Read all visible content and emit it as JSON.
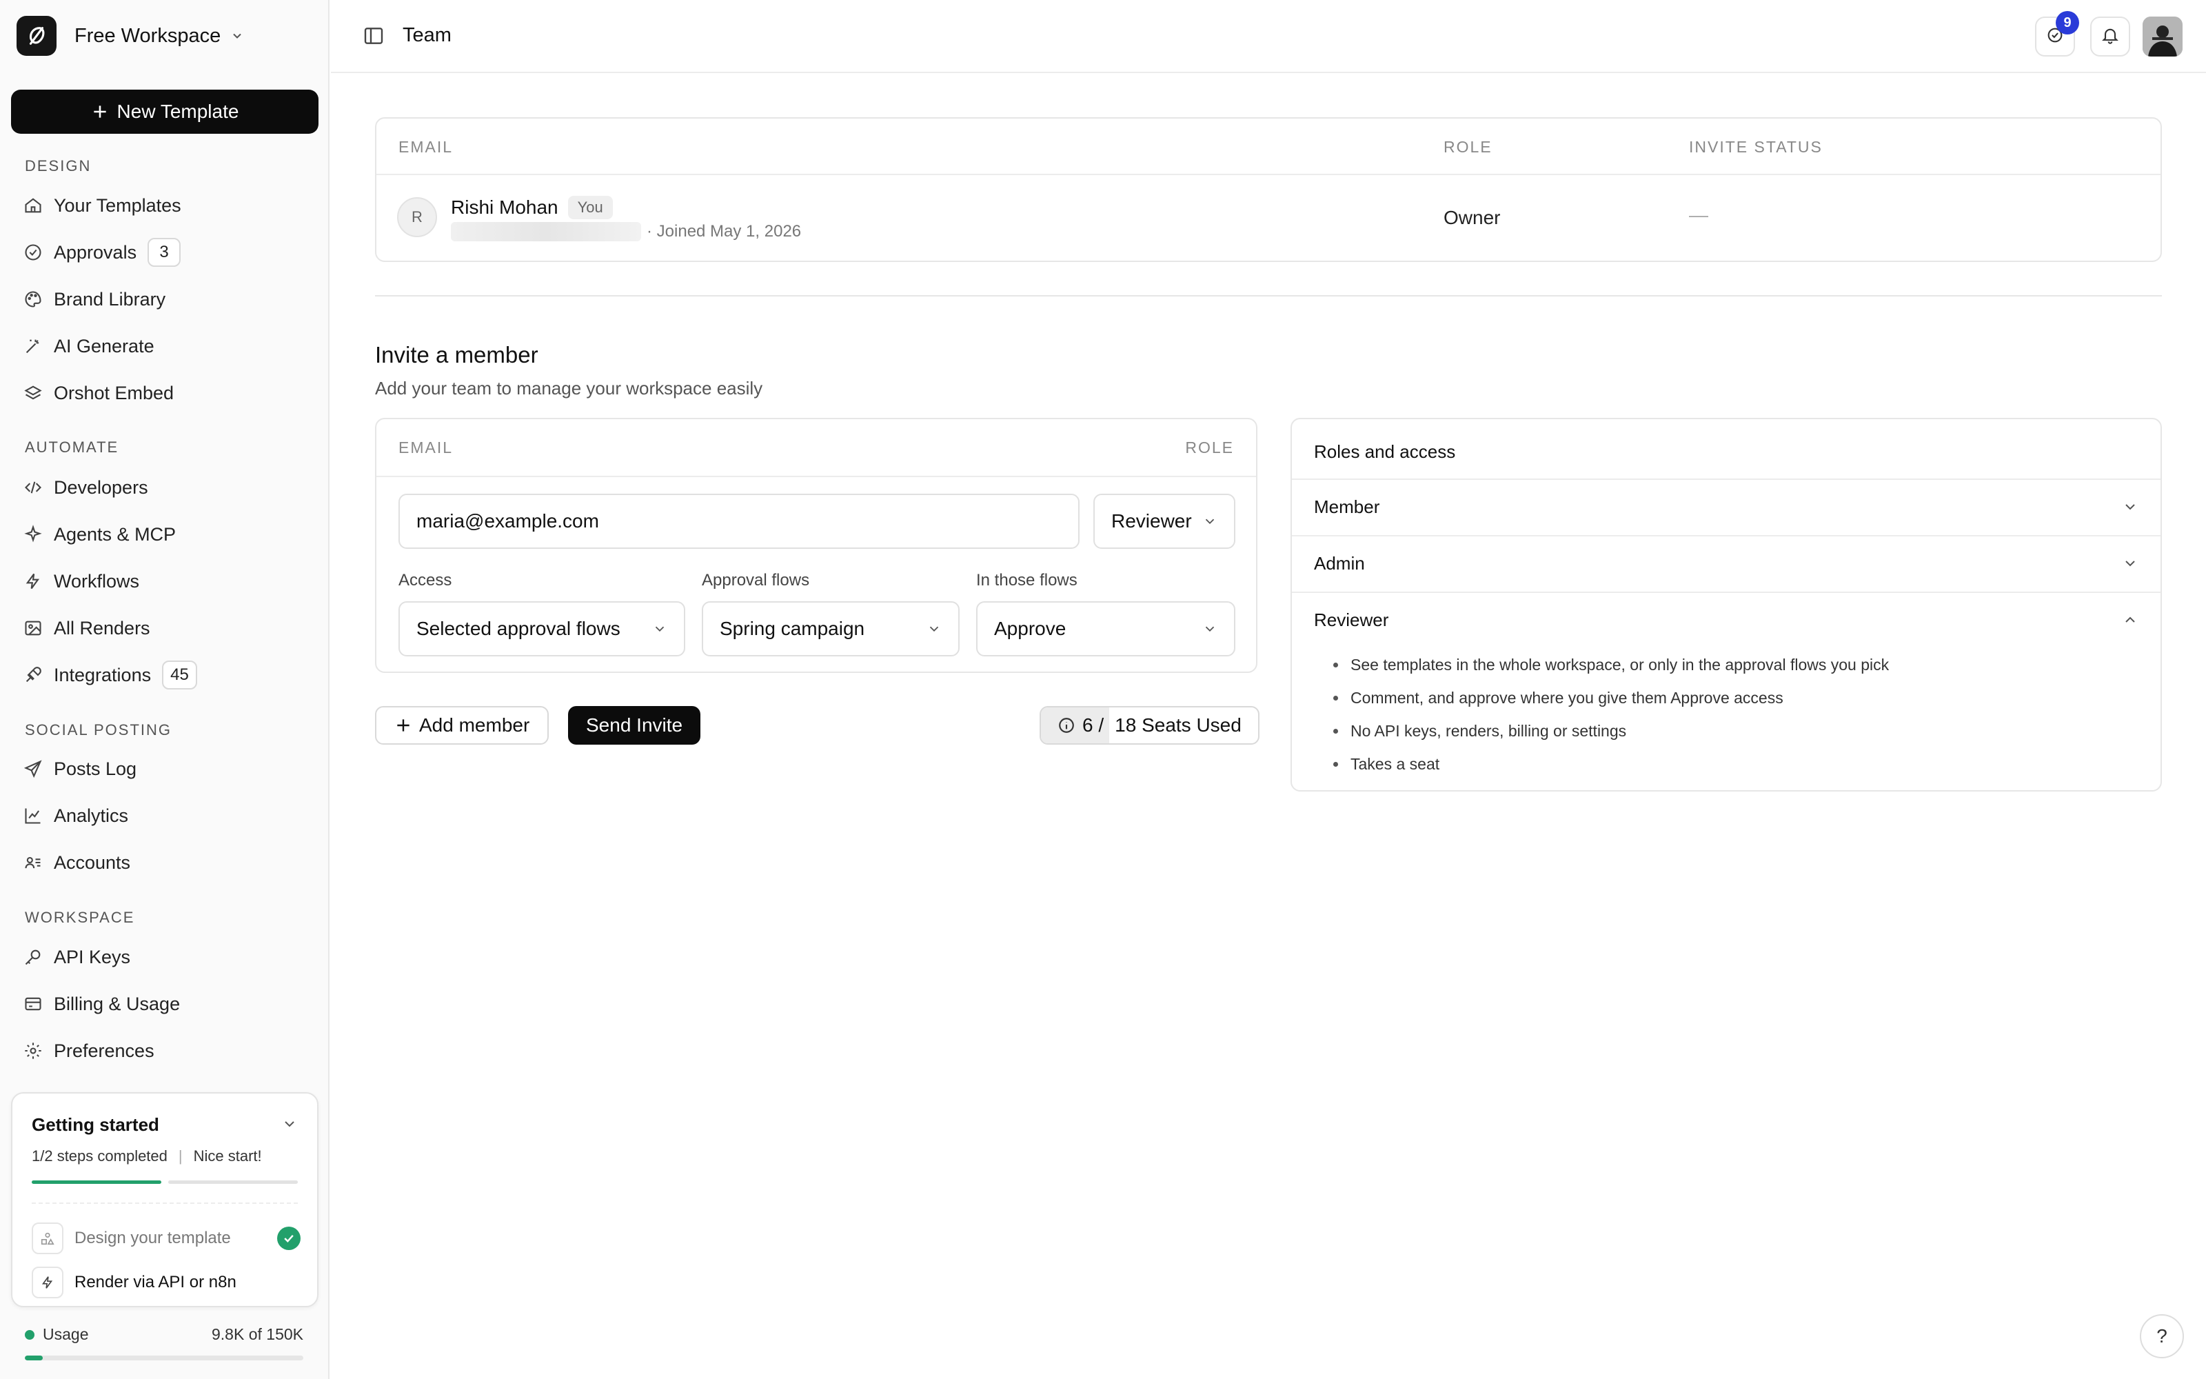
{
  "workspace": {
    "name": "Free Workspace"
  },
  "sidebar": {
    "new_template": "New Template",
    "sections": {
      "design": "DESIGN",
      "automate": "AUTOMATE",
      "social": "SOCIAL POSTING",
      "workspace": "WORKSPACE"
    },
    "items": [
      {
        "label": "Your Templates",
        "icon": "home-icon"
      },
      {
        "label": "Approvals",
        "icon": "check-circle-icon",
        "badge": "3"
      },
      {
        "label": "Brand Library",
        "icon": "palette-icon"
      },
      {
        "label": "AI Generate",
        "icon": "magic-wand-icon"
      },
      {
        "label": "Orshot Embed",
        "icon": "layers-icon"
      },
      {
        "label": "Developers",
        "icon": "code-icon"
      },
      {
        "label": "Agents & MCP",
        "icon": "sparkle-icon"
      },
      {
        "label": "Workflows",
        "icon": "bolt-icon"
      },
      {
        "label": "All Renders",
        "icon": "image-icon"
      },
      {
        "label": "Integrations",
        "icon": "plug-icon",
        "badge": "45"
      },
      {
        "label": "Posts Log",
        "icon": "send-icon"
      },
      {
        "label": "Analytics",
        "icon": "chart-line-icon"
      },
      {
        "label": "Accounts",
        "icon": "users-icon"
      },
      {
        "label": "API Keys",
        "icon": "key-icon"
      },
      {
        "label": "Billing & Usage",
        "icon": "credit-card-icon"
      },
      {
        "label": "Preferences",
        "icon": "gear-icon"
      }
    ],
    "getting_started": {
      "title": "Getting started",
      "steps_text": "1/2 steps completed",
      "encouragement": "Nice start!",
      "progress": 0.5,
      "steps": [
        {
          "label": "Design your template",
          "done": true
        },
        {
          "label": "Render via API or n8n",
          "done": false
        }
      ]
    },
    "usage": {
      "label": "Usage",
      "value": "9.8K of 150K",
      "fraction": 0.065
    }
  },
  "topbar": {
    "title": "Team",
    "notification_badge": "9"
  },
  "team_table": {
    "headers": {
      "email": "EMAIL",
      "role": "ROLE",
      "status": "INVITE STATUS"
    },
    "rows": [
      {
        "initial": "R",
        "name": "Rishi Mohan",
        "tag": "You",
        "meta": "· Joined May 1, 2026",
        "role": "Owner",
        "status": "—"
      }
    ]
  },
  "invite": {
    "title": "Invite a member",
    "subtitle": "Add your team to manage your workspace easily",
    "headers": {
      "email": "EMAIL",
      "role": "ROLE"
    },
    "email_value": "maria@example.com",
    "role_value": "Reviewer",
    "fields": {
      "access_label": "Access",
      "access_value": "Selected approval flows",
      "flows_label": "Approval flows",
      "flows_value": "Spring campaign",
      "in_flows_label": "In those flows",
      "in_flows_value": "Approve"
    },
    "add_member": "Add member",
    "send_invite": "Send Invite",
    "seats_used": "6 /",
    "seats_rest": "18 Seats Used"
  },
  "roles": {
    "title": "Roles and access",
    "items": [
      {
        "name": "Member",
        "expanded": false
      },
      {
        "name": "Admin",
        "expanded": false
      },
      {
        "name": "Reviewer",
        "expanded": true
      }
    ],
    "reviewer_points": [
      "See templates in the whole workspace, or only in the approval flows you pick",
      "Comment, and approve where you give them Approve access",
      "No API keys, renders, billing or settings",
      "Takes a seat"
    ]
  },
  "help": {
    "label": "?"
  }
}
